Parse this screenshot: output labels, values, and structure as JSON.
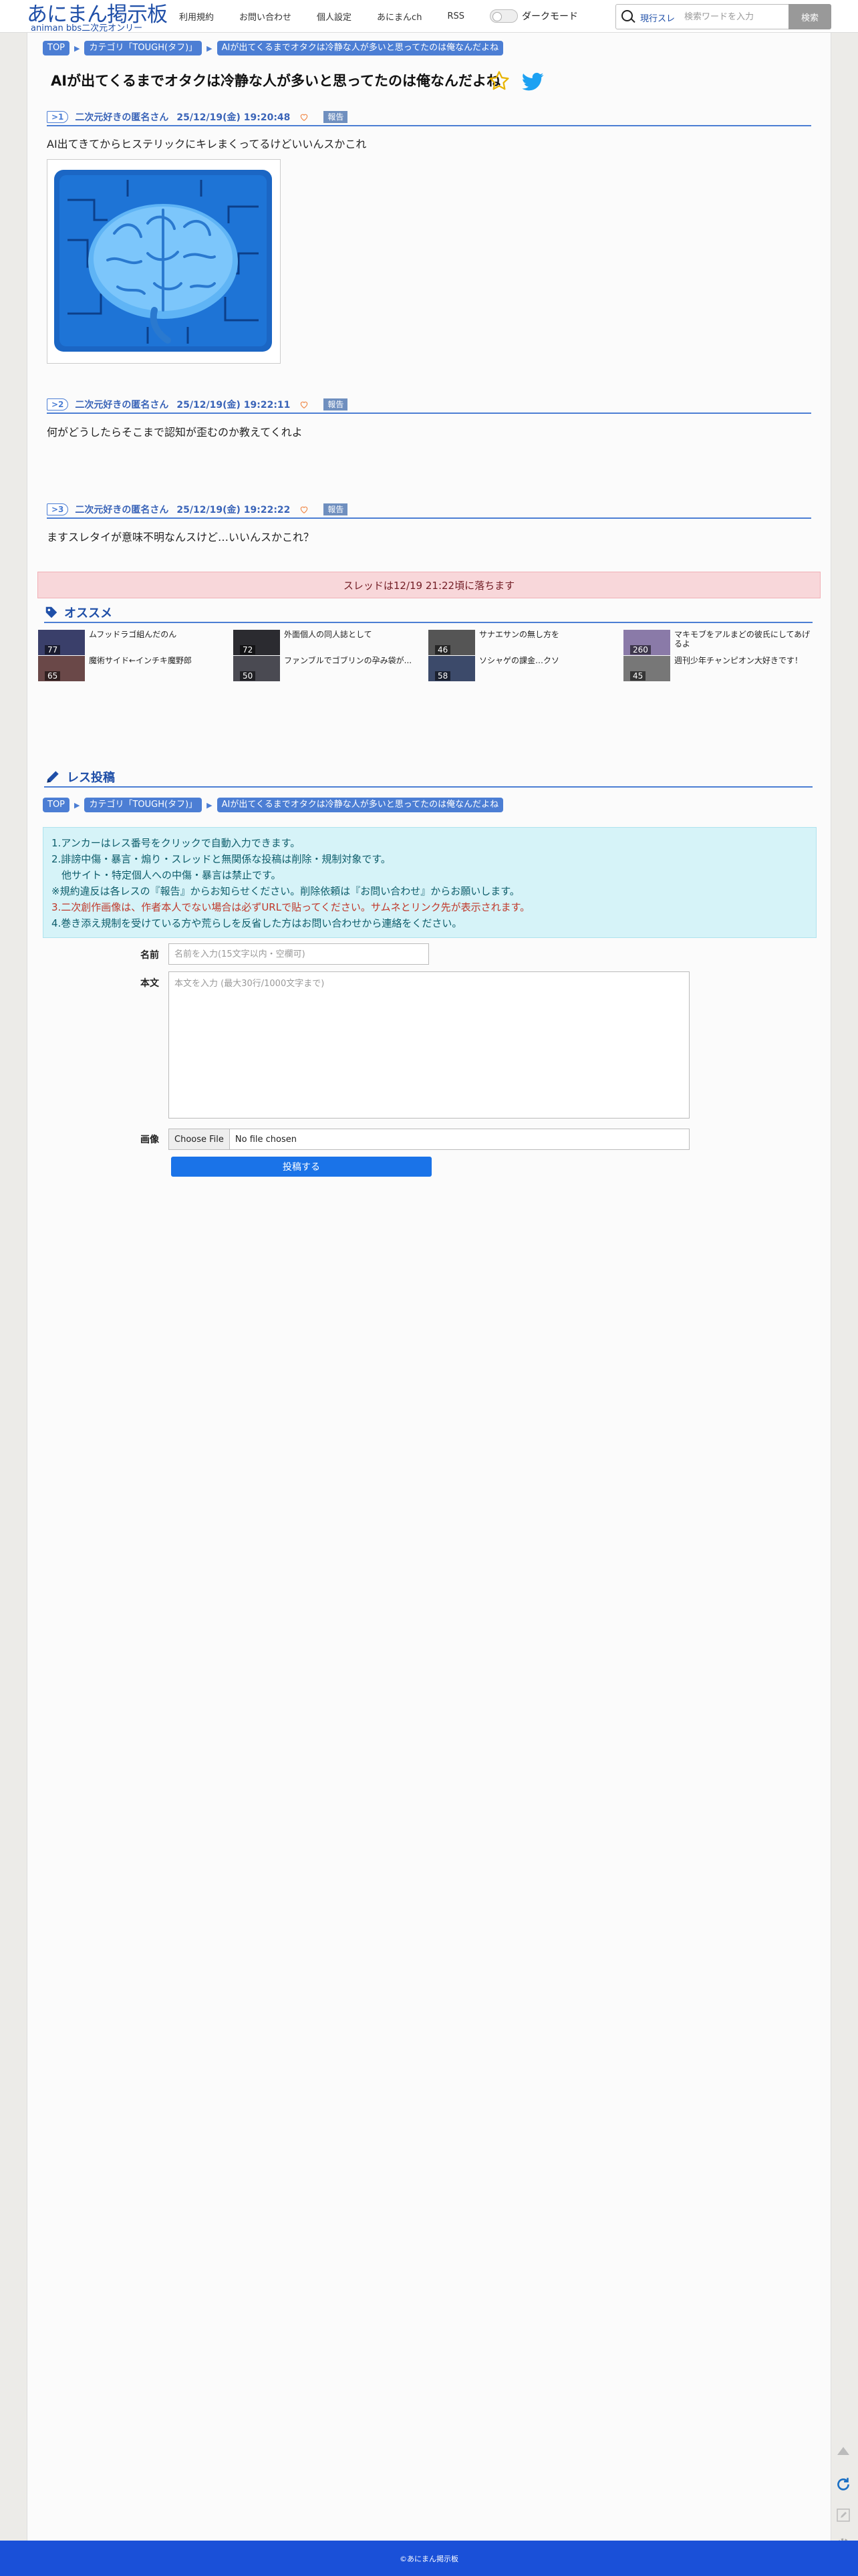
{
  "header": {
    "logo_main": "あにまん掲示板",
    "logo_sub": "animan bbs二次元オンリー",
    "nav": [
      "利用規約",
      "お問い合わせ",
      "個人設定",
      "あにまんch",
      "RSS"
    ],
    "dark_mode_label": "ダークモード",
    "search_scope": "現行スレ",
    "search_placeholder": "検索ワードを入力",
    "search_button": "検索"
  },
  "breadcrumb": [
    "TOP",
    "カテゴリ「TOUGH(タフ)」",
    "AIが出てくるまでオタクは冷静な人が多いと思ってたのは俺なんだよね"
  ],
  "thread": {
    "title": "AIが出てくるまでオタクは冷静な人が多いと思ってたのは俺なんだよね"
  },
  "posts": [
    {
      "no": ">1",
      "name": "二次元好きの匿名さん",
      "date": "25/12/19(金) 19:20:48",
      "report": "報告",
      "body": "AI出てきてからヒステリックにキレまくってるけどいいんスかこれ",
      "has_image": true
    },
    {
      "no": ">2",
      "name": "二次元好きの匿名さん",
      "date": "25/12/19(金) 19:22:11",
      "report": "報告",
      "body": "何がどうしたらそこまで認知が歪むのか教えてくれよ",
      "has_image": false
    },
    {
      "no": ">3",
      "name": "二次元好きの匿名さん",
      "date": "25/12/19(金) 19:22:22",
      "report": "報告",
      "body": "ますスレタイが意味不明なんスけど…いいんスかこれ？",
      "has_image": false
    }
  ],
  "expiry_notice": "スレッドは12/19 21:22頃に落ちます",
  "recommend": {
    "title": "オススメ",
    "items": [
      {
        "text": "ムフッドラゴ組んだのん",
        "count": "77"
      },
      {
        "text": "外面個人の同人誌として",
        "count": "72"
      },
      {
        "text": "サナエサンの無し方を",
        "count": "46"
      },
      {
        "text": "マキモブをアルまどの彼氏にしてあげるよ",
        "count": "260"
      },
      {
        "text": "魔術サイド←インチキ魔野郎",
        "count": "65"
      },
      {
        "text": "ファンブルでゴブリンの孕み袋が...",
        "count": "50"
      },
      {
        "text": "ソシャゲの課金…クソ",
        "count": "58"
      },
      {
        "text": "週刊少年チャンピオン大好きです！",
        "count": "45"
      }
    ]
  },
  "reply": {
    "title": "レス投稿",
    "info": [
      "1.アンカーはレス番号をクリックで自動入力できます。",
      "2.誹謗中傷・暴言・煽り・スレッドと無関係な投稿は削除・規制対象です。",
      "　他サイト・特定個人への中傷・暴言は禁止です。",
      "※規約違反は各レスの『報告』からお知らせください。削除依頼は『お問い合わせ』からお願いします。",
      "3.二次創作画像は、作者本人でない場合は必ずURLで貼ってください。サムネとリンク先が表示されます。",
      "4.巻き添え規制を受けている方や荒らしを反省した方はお問い合わせから連絡をください。"
    ],
    "name_label": "名前",
    "name_placeholder": "名前を入力(15文字以内・空欄可)",
    "body_label": "本文",
    "body_placeholder": "本文を入力 (最大30行/1000文字まで)",
    "image_label": "画像",
    "file_button": "Choose File",
    "file_status": "No file chosen",
    "submit": "投稿する"
  },
  "footer": "©あにまん掲示板",
  "colors": {
    "accent": "#4c7ed4",
    "footer": "#1a50d8",
    "submit": "#1a73e8",
    "notice_bg": "#f8d7da",
    "info_bg": "#d6f3f8"
  }
}
